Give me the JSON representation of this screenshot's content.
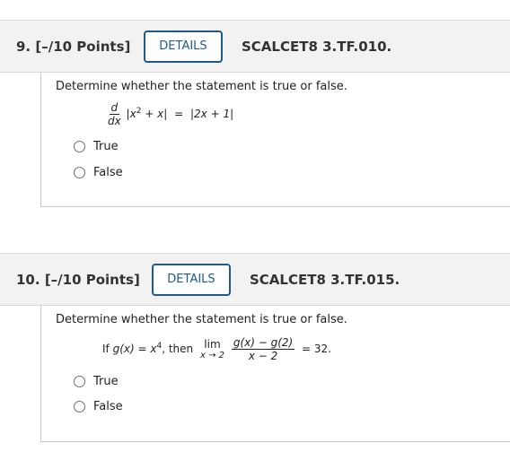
{
  "questions": [
    {
      "number": "9.",
      "points": "[–/10 Points]",
      "details_label": "DETAILS",
      "code": "SCALCET8 3.TF.010.",
      "prompt": "Determine whether the statement is true or false.",
      "statement": {
        "deriv_num": "d",
        "deriv_den": "dx",
        "lhs_open": "|x",
        "lhs_exp": "2",
        "lhs_close": " + x|",
        "equals": "=",
        "rhs": "|2x + 1|"
      },
      "options": [
        "True",
        "False"
      ]
    },
    {
      "number": "10.",
      "points": "[–/10 Points]",
      "details_label": "DETAILS",
      "code": "SCALCET8 3.TF.015.",
      "prompt": "Determine whether the statement is true or false.",
      "statement": {
        "if_text": "If",
        "gx": "g(x) = x",
        "gx_exp": "4",
        "then_text": ", then",
        "lim": "lim",
        "lim_sub": "x → 2",
        "frac_num": "g(x) − g(2)",
        "frac_den": "x − 2",
        "result": "= 32."
      },
      "options": [
        "True",
        "False"
      ]
    }
  ]
}
